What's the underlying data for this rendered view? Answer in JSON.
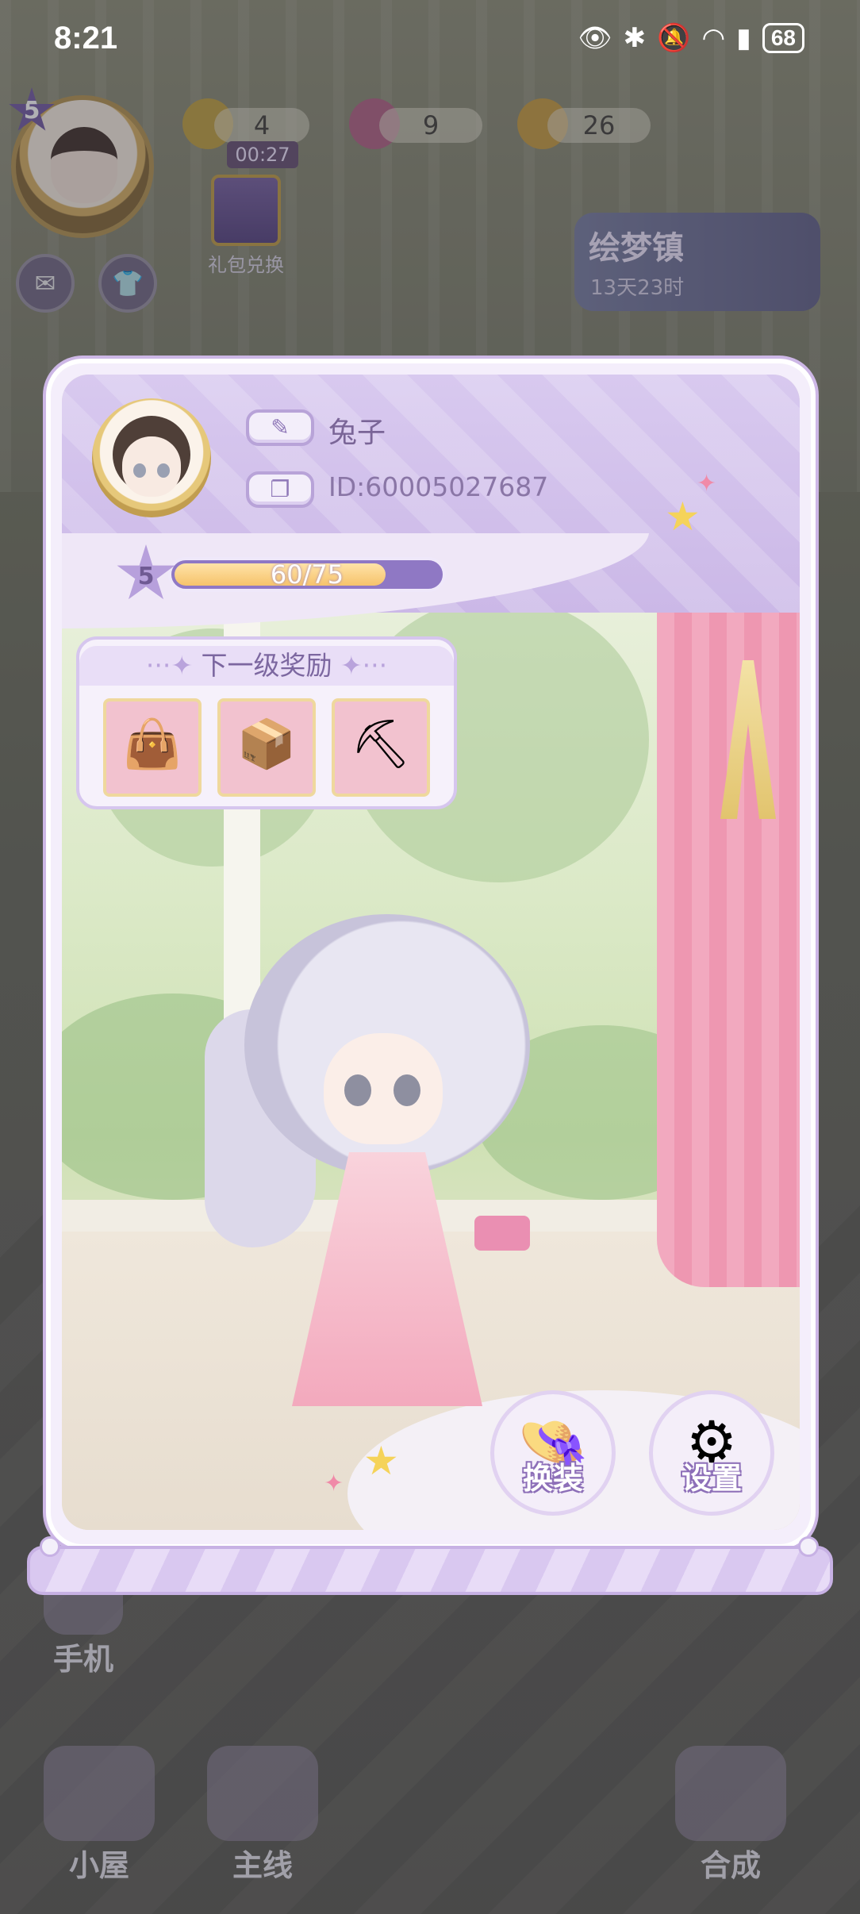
{
  "status_bar": {
    "time": "8:21",
    "battery": "68"
  },
  "hud": {
    "player_level": "5",
    "energy": "4",
    "energy_timer": "00:27",
    "gems": "9",
    "coins": "26",
    "gift_label": "礼包兑换",
    "event_title": "绘梦镇",
    "event_time": "13天23时"
  },
  "profile": {
    "name": "兔子",
    "id": "ID:60005027687",
    "level": "5",
    "xp_text": "60/75",
    "xp_progress": 0.8,
    "rewards_title": "下一级奖励",
    "rewards": [
      "bag-icon",
      "treasure-box-icon",
      "shovel-icon"
    ],
    "dress_up_label": "换装",
    "settings_label": "设置"
  },
  "bottom_nav": {
    "phone": "手机",
    "house": "小屋",
    "main_quest": "主线",
    "merge": "合成"
  },
  "colors": {
    "panel_accent": "#cbb8e7",
    "xp_fill": "#f6c36b",
    "xp_track": "#8f78c4"
  }
}
